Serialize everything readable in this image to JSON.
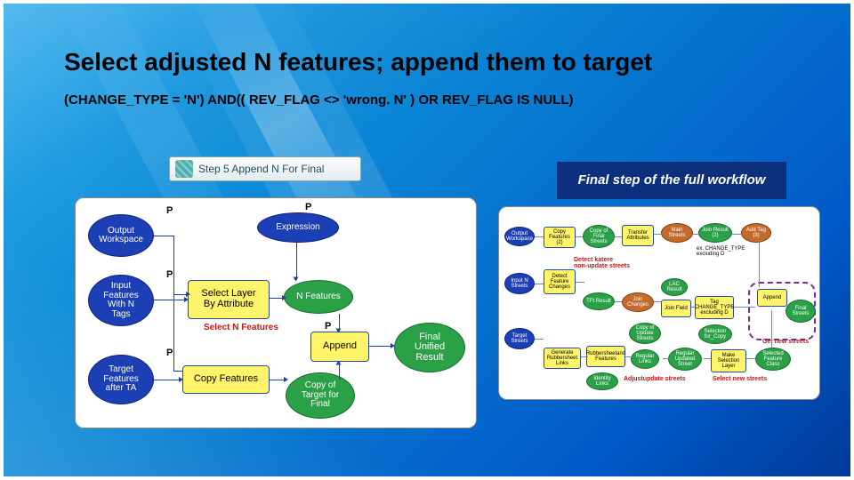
{
  "title": "Select adjusted N features; append them to target",
  "subtitle": "(CHANGE_TYPE = 'N') AND(( REV_FLAG <> 'wrong. N' ) OR REV_FLAG IS NULL)",
  "step_chip": "Step 5 Append N For Final",
  "banner": "Final step of the full workflow",
  "p": "P",
  "left": {
    "output_ws": "Output\nWorkspace",
    "input_n": "Input\nFeatures\nWith N\nTags",
    "target_ta": "Target\nFeatures\nafter TA",
    "expression": "Expression",
    "select_layer": "Select Layer\nBy Attribute",
    "copy_feat": "Copy Features",
    "n_features": "N Features",
    "append": "Append",
    "copy_target": "Copy of\nTarget for\nFinal",
    "final": "Final\nUnified\nResult",
    "cap_select": "Select N Features"
  },
  "right": {
    "col1": [
      "Output\nWorkspace",
      "Input N\nStreets",
      "Target\nStreets"
    ],
    "col2": [
      "Copy\nFeatures\n(2)",
      "Detect\nFeature\nChanges",
      "Generate\nRubbersheet\nLinks"
    ],
    "col3": [
      "Copy of\nFinal\nStreets",
      "TFt Result",
      "Rubbersheetand\nFeatures",
      "Identity\nLinks"
    ],
    "col4": [
      "Transfer\nAttributes",
      "Join\nChanges",
      "Copy of\nUpdate\nStreets",
      "Regular\nLinks"
    ],
    "col5": [
      "Main\nStreets",
      "LAC\nResult",
      "Join Field",
      "Regular\nUpdated\nStreet"
    ],
    "col6": [
      "Join Result\n(2)",
      "Tag CHANGE_TYPE\nexcluding D",
      "Selection\nfor_Copy",
      "Make\nSelection\nLayer"
    ],
    "col7": [
      "Add Tag\n(3)",
      "Append",
      "Selected\nFeature\nClass"
    ],
    "col8": "Final\nStreets",
    "tag_top": "ex. CHANGE_TYPE\nexcluding D",
    "red1": "Detect katere\nnon-update streets",
    "red2": "Adjustupdate streets",
    "red3": "Select new streets",
    "red4": "Get new streets"
  }
}
